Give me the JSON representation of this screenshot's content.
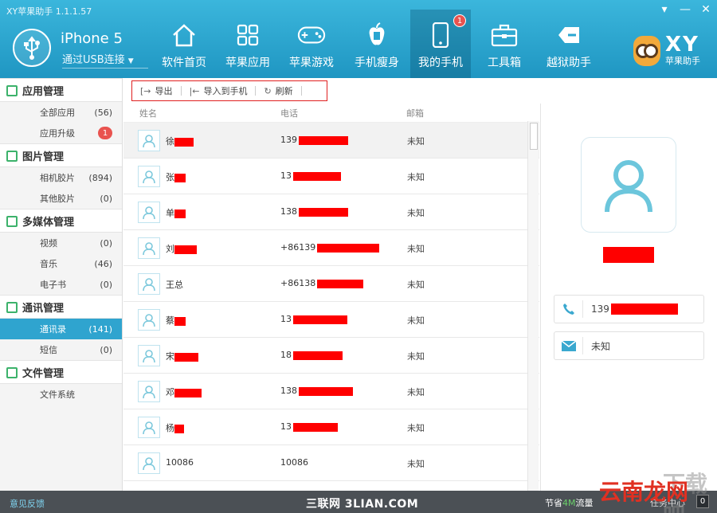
{
  "app": {
    "title": "XY苹果助手 1.1.1.57",
    "device_name": "iPhone 5",
    "connection": "通过USB连接",
    "window_controls": [
      "▾",
      "—",
      "✕"
    ]
  },
  "nav": [
    {
      "label": "软件首页",
      "icon": "home-icon"
    },
    {
      "label": "苹果应用",
      "icon": "grid-icon"
    },
    {
      "label": "苹果游戏",
      "icon": "gamepad-icon"
    },
    {
      "label": "手机瘦身",
      "icon": "apple-slim-icon"
    },
    {
      "label": "我的手机",
      "icon": "phone-icon",
      "badge": "1",
      "active": true
    },
    {
      "label": "工具箱",
      "icon": "toolbox-icon"
    },
    {
      "label": "越狱助手",
      "icon": "jailbreak-icon"
    }
  ],
  "brand": {
    "logo_text": "XY",
    "sub": "苹果助手"
  },
  "sidebar": {
    "sections": [
      {
        "title": "应用管理",
        "icon": "apps-icon",
        "items": [
          {
            "label": "全部应用",
            "count": "(56)"
          },
          {
            "label": "应用升级",
            "count": "1",
            "badge": true
          }
        ]
      },
      {
        "title": "图片管理",
        "icon": "picture-icon",
        "items": [
          {
            "label": "相机胶片",
            "count": "(894)"
          },
          {
            "label": "其他胶片",
            "count": "(0)"
          }
        ]
      },
      {
        "title": "多媒体管理",
        "icon": "media-icon",
        "items": [
          {
            "label": "视频",
            "count": "(0)"
          },
          {
            "label": "音乐",
            "count": "(46)"
          },
          {
            "label": "电子书",
            "count": "(0)"
          }
        ]
      },
      {
        "title": "通讯管理",
        "icon": "chat-icon",
        "items": [
          {
            "label": "通讯录",
            "count": "(141)",
            "active": true
          },
          {
            "label": "短信",
            "count": "(0)"
          }
        ]
      },
      {
        "title": "文件管理",
        "icon": "file-icon",
        "items": [
          {
            "label": "文件系统",
            "count": ""
          }
        ]
      }
    ]
  },
  "toolbar": {
    "export": "导出",
    "import": "导入到手机",
    "refresh": "刷新"
  },
  "table": {
    "headers": {
      "name": "姓名",
      "phone": "电话",
      "email": "邮箱"
    },
    "rows": [
      {
        "name": "徐",
        "phone": "139",
        "email": "未知"
      },
      {
        "name": "张",
        "phone": "13",
        "email": "未知"
      },
      {
        "name": "单",
        "phone": "138",
        "email": "未知"
      },
      {
        "name": "刘",
        "phone": "+86139",
        "email": "未知"
      },
      {
        "name": "王总",
        "phone": "+86138",
        "email": "未知"
      },
      {
        "name": "蔡",
        "phone": "13",
        "email": "未知"
      },
      {
        "name": "宋",
        "phone": "18",
        "email": "未知"
      },
      {
        "name": "邓",
        "phone": "138",
        "email": "未知"
      },
      {
        "name": "杨",
        "phone": "13",
        "email": "未知"
      },
      {
        "name": "10086",
        "phone": "10086",
        "email": "未知"
      }
    ]
  },
  "detail": {
    "phone": "139",
    "email": "未知"
  },
  "statusbar": {
    "feedback": "意见反馈",
    "watermark": "三联网 3LIAN.COM",
    "save_prefix": "节省",
    "save_highlight": "4M",
    "save_suffix": "流量",
    "task_center": "任务中心",
    "task_count": "0"
  },
  "site_logo": {
    "text": "云南龙网",
    "faded": "下载吧"
  },
  "colors": {
    "header": "#2aa6d1",
    "active_nav": "#1b7fa6",
    "redaction": "#ff0000",
    "accent": "#2fa4cf"
  }
}
